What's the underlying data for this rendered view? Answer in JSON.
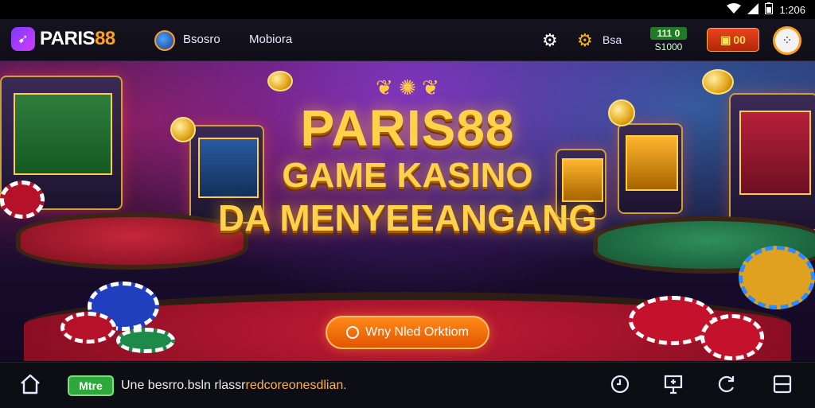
{
  "status_bar": {
    "time": "1:206",
    "icons": [
      "wifi-icon",
      "signal-icon",
      "battery-icon"
    ]
  },
  "header": {
    "logo_text_main": "PARIS",
    "logo_text_num": "88",
    "nav": [
      "Bsosro",
      "Mobiora"
    ],
    "settings_icon": "gear-icon",
    "promo_label": "Bsa",
    "promo_icon": "sun-gear-icon",
    "balance_top": "111 0",
    "balance_bottom": "S1000",
    "wallet_text": "00",
    "profile_icon": "dots-circle-icon"
  },
  "hero": {
    "line1": "PARIS88",
    "line2": "GAME KASINO",
    "line3": "DA MENYEEANGANG",
    "cta_label": "Wny Nled Orktiom"
  },
  "bottom_bar": {
    "home_icon": "home-icon",
    "badge": "Mtre",
    "ticker_prefix": "Une besrro.bsln rlassr",
    "ticker_highlight": "redcoreonesdlian.",
    "icons": [
      "clock-icon",
      "presentation-icon",
      "refresh-icon",
      "menu-panel-icon"
    ]
  },
  "colors": {
    "accent": "#ff9f1a",
    "brand_purple": "#7a3bff",
    "title_gold": "#ffd24a",
    "cta_orange": "#ff8a1a",
    "badge_green": "#2ea83a"
  }
}
